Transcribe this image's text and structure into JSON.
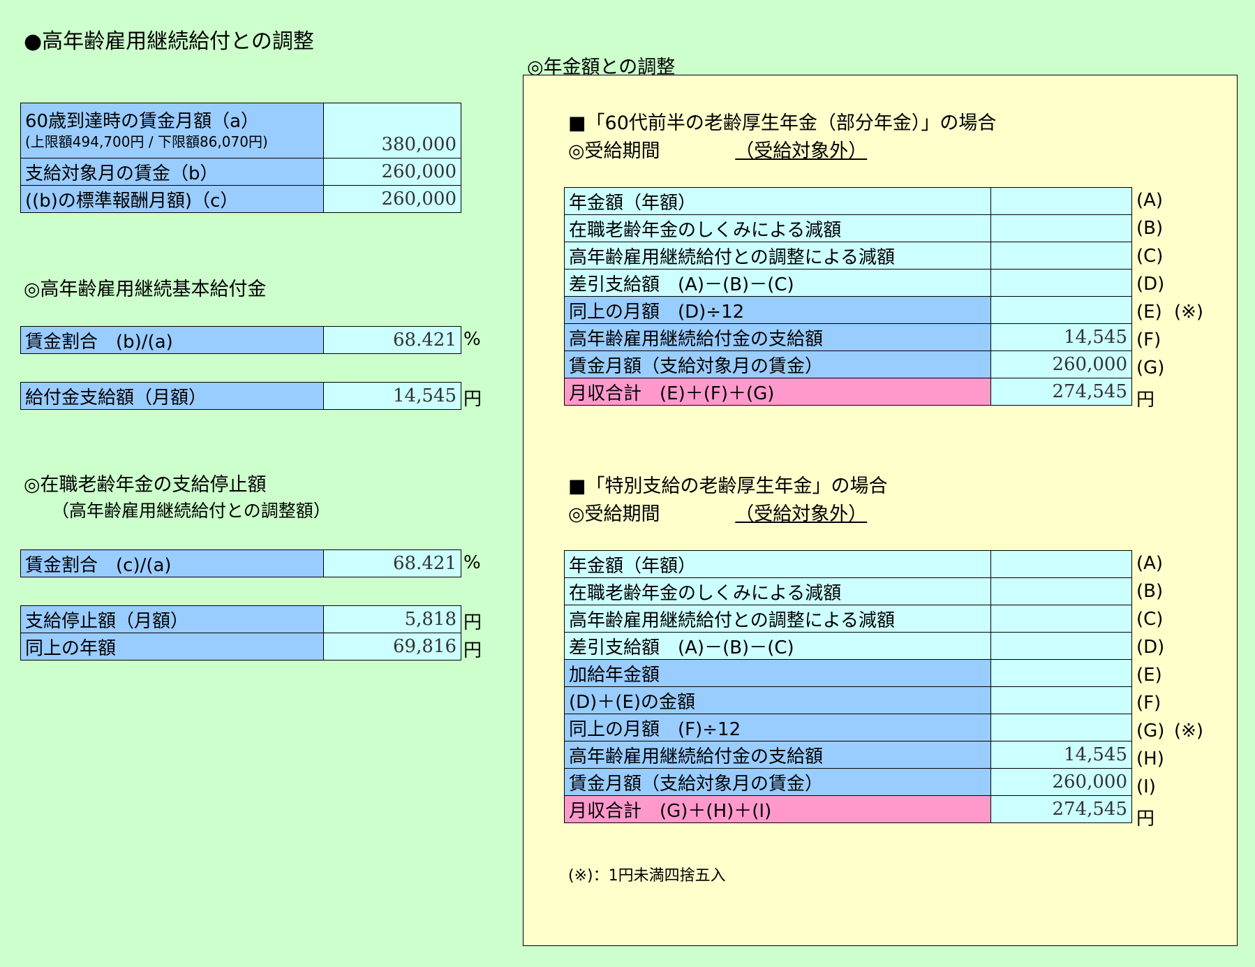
{
  "title": "●高年齢雇用継続給付との調整",
  "left": {
    "wage_table": {
      "rows": [
        {
          "label1": "60歳到達時の賃金月額（a）",
          "label2": "(上限額494,700円 / 下限額86,070円)",
          "value": "380,000"
        },
        {
          "label": "支給対象月の賃金（b）",
          "value": "260,000"
        },
        {
          "label": "((b)の標準報酬月額)（c）",
          "value": "260,000"
        }
      ]
    },
    "basic_benefit": {
      "heading": "◎高年齢雇用継続基本給付金",
      "ratio_label": "賃金割合　(b)/(a)",
      "ratio_value": "68.421",
      "ratio_unit": "%",
      "amount_label": "給付金支給額（月額）",
      "amount_value": "14,545",
      "amount_unit": "円"
    },
    "suspension": {
      "heading": "◎在職老齢年金の支給停止額",
      "subheading": "（高年齢雇用継続給付との調整額）",
      "ratio_label": "賃金割合　(c)/(a)",
      "ratio_value": "68.421",
      "ratio_unit": "%",
      "monthly_label": "支給停止額（月額）",
      "monthly_value": "5,818",
      "monthly_unit": "円",
      "annual_label": "同上の年額",
      "annual_value": "69,816",
      "annual_unit": "円"
    }
  },
  "right": {
    "heading": "◎年金額との調整",
    "case1": {
      "title": "■「60代前半の老齢厚生年金（部分年金）」の場合",
      "period_label": "◎受給期間",
      "period_value": "（受給対象外）",
      "rows": [
        {
          "label": "年金額（年額）",
          "value": "",
          "mark": "(A)",
          "note": ""
        },
        {
          "label": "在職老齢年金のしくみによる減額",
          "value": "",
          "mark": "(B)",
          "note": ""
        },
        {
          "label": "高年齢雇用継続給付との調整による減額",
          "value": "",
          "mark": "(C)",
          "note": ""
        },
        {
          "label": "差引支給額　(A)－(B)－(C)",
          "value": "",
          "mark": "(D)",
          "note": ""
        },
        {
          "label": "同上の月額　(D)÷12",
          "value": "",
          "mark": "(E)",
          "note": "(※)"
        },
        {
          "label": "高年齢雇用継続給付金の支給額",
          "value": "14,545",
          "mark": "(F)",
          "note": ""
        },
        {
          "label": "賃金月額（支給対象月の賃金）",
          "value": "260,000",
          "mark": "(G)",
          "note": ""
        },
        {
          "label": "月収合計　(E)＋(F)＋(G)",
          "value": "274,545",
          "mark": "円",
          "note": ""
        }
      ]
    },
    "case2": {
      "title": "■「特別支給の老齢厚生年金」の場合",
      "period_label": "◎受給期間",
      "period_value": "（受給対象外）",
      "rows": [
        {
          "label": "年金額（年額）",
          "value": "",
          "mark": "(A)",
          "note": ""
        },
        {
          "label": "在職老齢年金のしくみによる減額",
          "value": "",
          "mark": "(B)",
          "note": ""
        },
        {
          "label": "高年齢雇用継続給付との調整による減額",
          "value": "",
          "mark": "(C)",
          "note": ""
        },
        {
          "label": "差引支給額　(A)－(B)－(C)",
          "value": "",
          "mark": "(D)",
          "note": ""
        },
        {
          "label": "加給年金額",
          "value": "",
          "mark": "(E)",
          "note": ""
        },
        {
          "label": "(D)＋(E)の金額",
          "value": "",
          "mark": "(F)",
          "note": ""
        },
        {
          "label": "同上の月額　(F)÷12",
          "value": "",
          "mark": "(G)",
          "note": "(※)"
        },
        {
          "label": "高年齢雇用継続給付金の支給額",
          "value": "14,545",
          "mark": "(H)",
          "note": ""
        },
        {
          "label": "賃金月額（支給対象月の賃金）",
          "value": "260,000",
          "mark": "(I)",
          "note": ""
        },
        {
          "label": "月収合計　(G)＋(H)＋(I)",
          "value": "274,545",
          "mark": "円",
          "note": ""
        }
      ]
    },
    "footnote": "(※)：1円未満四捨五入"
  }
}
